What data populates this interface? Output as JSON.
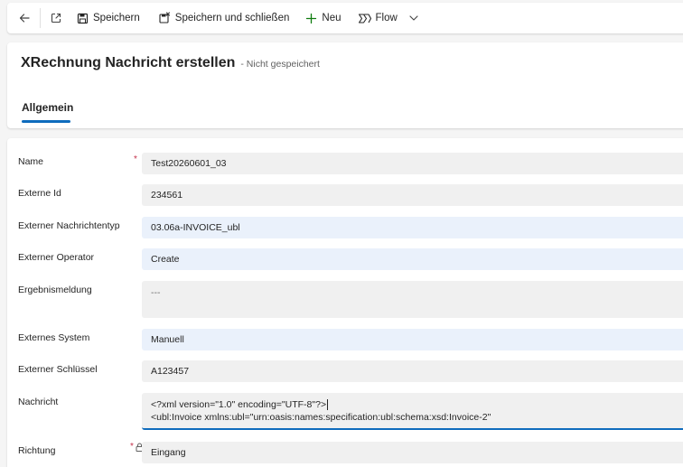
{
  "toolbar": {
    "save": "Speichern",
    "save_close": "Speichern und schließen",
    "new": "Neu",
    "flow": "Flow"
  },
  "header": {
    "title": "XRechnung Nachricht erstellen",
    "subtitle": "- Nicht gespeichert",
    "tab": "Allgemein"
  },
  "form": {
    "name": {
      "label": "Name",
      "value": "Test20260601_03"
    },
    "externe_id": {
      "label": "Externe Id",
      "value": "234561"
    },
    "nachrichtentyp": {
      "label": "Externer Nachrichtentyp",
      "value": "03.06a-INVOICE_ubl"
    },
    "operator": {
      "label": "Externer Operator",
      "value": "Create"
    },
    "ergebnis": {
      "label": "Ergebnismeldung",
      "value": "---"
    },
    "system": {
      "label": "Externes System",
      "value": "Manuell"
    },
    "schluessel": {
      "label": "Externer Schlüssel",
      "value": "A123457"
    },
    "nachricht": {
      "label": "Nachricht",
      "line1": "<?xml version=\"1.0\" encoding=\"UTF-8\"?>",
      "line2": "<ubl:Invoice xmlns:ubl=\"urn:oasis:names:specification:ubl:schema:xsd:Invoice-2\""
    },
    "richtung": {
      "label": "Richtung",
      "value": "Eingang"
    },
    "required_mark": "*"
  },
  "colors": {
    "accent": "#0f6cbd",
    "required": "#c4314b"
  }
}
